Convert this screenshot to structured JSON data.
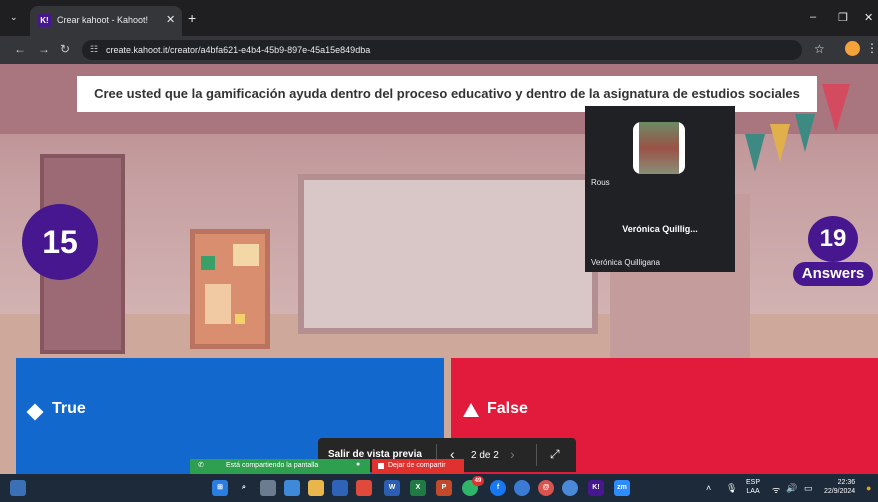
{
  "browser": {
    "tab_title": "Crear kahoot - Kahoot!",
    "tab_favicon": "K!",
    "url": "create.kahoot.it/creator/a4bfa621-e4b4-45b9-897e-45a15e849dba"
  },
  "quiz": {
    "question": "Cree usted que la gamificación ayuda dentro del proceso educativo y dentro de la asignatura de estudios sociales",
    "timer": "15",
    "answers_count": "19",
    "answers_label": "Answers",
    "options": [
      {
        "label": "True",
        "color": "#1368ce",
        "shape": "diamond"
      },
      {
        "label": "False",
        "color": "#e21b3c",
        "shape": "triangle"
      }
    ]
  },
  "participant": {
    "top_label": "Rous",
    "name": "Verónica  Quillig...",
    "footer_name": "Verónica Quilligana"
  },
  "preview_bar": {
    "exit_label": "Salir de vista previa",
    "page": "2 de 2"
  },
  "sharing": {
    "status": "Está compartiendo la pantalla",
    "stop": "Dejar de compartir"
  },
  "taskbar": {
    "lang_top": "ESP",
    "lang_bottom": "LAA",
    "time": "22:36",
    "date": "22/9/2024",
    "badge": "49"
  },
  "colors": {
    "kahoot_purple": "#46178f",
    "true_blue": "#1368ce",
    "false_red": "#e21b3c"
  }
}
